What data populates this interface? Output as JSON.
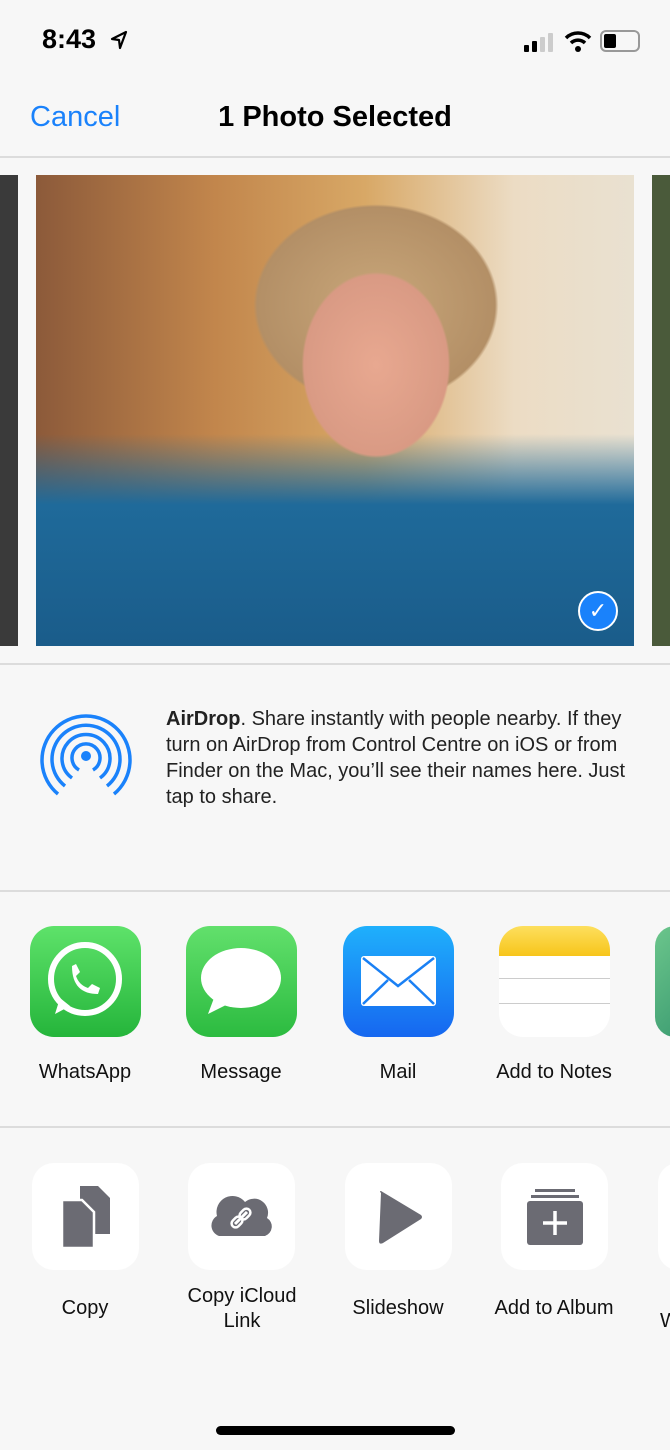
{
  "status_bar": {
    "time": "8:43",
    "icons": [
      "location-arrow-icon",
      "signal-icon",
      "wifi-icon",
      "battery-icon"
    ]
  },
  "nav": {
    "cancel": "Cancel",
    "title": "1 Photo Selected"
  },
  "photos": {
    "selected": true
  },
  "airdrop": {
    "title": "AirDrop",
    "text": ". Share instantly with people nearby. If they turn on AirDrop from Control Centre on iOS or from Finder on the Mac, you’ll see their names here. Just tap to share."
  },
  "apps": [
    {
      "label": "WhatsApp"
    },
    {
      "label": "Message"
    },
    {
      "label": "Mail"
    },
    {
      "label": "Add to Notes"
    }
  ],
  "actions": [
    {
      "label": "Copy"
    },
    {
      "label": "Copy iCloud Link"
    },
    {
      "label": "Slideshow"
    },
    {
      "label": "Add to Album"
    },
    {
      "label": "W"
    }
  ],
  "colors": {
    "accent": "#1a82fb",
    "whatsapp": "#2fc043",
    "message": "#33c84a",
    "mail": "#1a8cf8",
    "icon_gray": "#6b6b73"
  }
}
